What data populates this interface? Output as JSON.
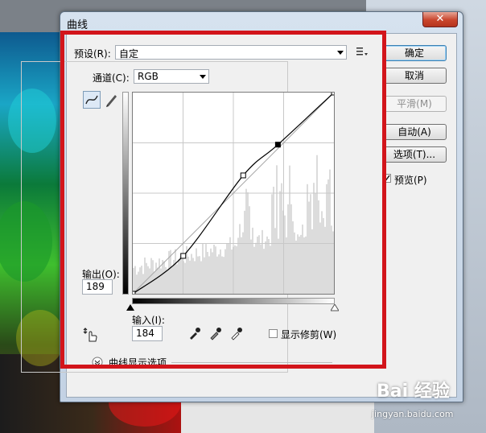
{
  "window": {
    "title": "曲线",
    "close_glyph": "✕"
  },
  "preset": {
    "label": "预设(R):",
    "value": "自定"
  },
  "channel": {
    "label": "通道(C):",
    "value": "RGB"
  },
  "buttons": {
    "ok": "确定",
    "cancel": "取消",
    "smooth": "平滑(M)",
    "auto": "自动(A)",
    "options": "选项(T)..."
  },
  "preview": {
    "label": "预览(P)",
    "checked": true
  },
  "output": {
    "label": "输出(O):",
    "value": "189"
  },
  "input": {
    "label": "输入(I):",
    "value": "184"
  },
  "show_clipping": {
    "label": "显示修剪(W)",
    "checked": false
  },
  "curve_options": {
    "label": "曲线显示选项"
  },
  "watermark": {
    "brand": "Bai 经验",
    "url": "jingyan.baidu.com"
  },
  "curve": {
    "points": [
      [
        0,
        0
      ],
      [
        64,
        48
      ],
      [
        140,
        150
      ],
      [
        184,
        189
      ],
      [
        255,
        255
      ]
    ],
    "selected_point": [
      184,
      189
    ]
  },
  "colors": {
    "highlight": "#d2151b",
    "accent": "#3c7fb1"
  }
}
